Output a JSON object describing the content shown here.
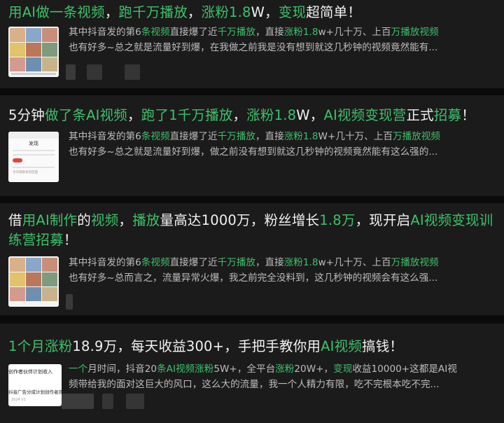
{
  "results": [
    {
      "title": [
        {
          "t": "用AI做一条视频",
          "hl": true
        },
        {
          "t": "，",
          "hl": false
        },
        {
          "t": "跑千万播放",
          "hl": true
        },
        {
          "t": "，",
          "hl": false
        },
        {
          "t": "涨粉1.8",
          "hl": true
        },
        {
          "t": "W，",
          "hl": false
        },
        {
          "t": "变现",
          "hl": true
        },
        {
          "t": "超简单！",
          "hl": false
        }
      ],
      "snippet_lines": [
        [
          {
            "t": "其中抖音发的第6",
            "hl": false
          },
          {
            "t": "条视频",
            "hl": true
          },
          {
            "t": "直接爆了近",
            "hl": false
          },
          {
            "t": "千万播放",
            "hl": true
          },
          {
            "t": "，直接",
            "hl": false
          },
          {
            "t": "涨粉1.8",
            "hl": true
          },
          {
            "t": "w+几十万、上百",
            "hl": false
          },
          {
            "t": "万播放视频",
            "hl": true
          }
        ],
        [
          {
            "t": "也有好多~总之就是流量好到爆，在我做之前我是没有想到就这几秒钟的视频竟然能有...",
            "hl": false
          }
        ]
      ]
    },
    {
      "title": [
        {
          "t": "5分钟",
          "hl": false
        },
        {
          "t": "做了条AI视频",
          "hl": true
        },
        {
          "t": "，",
          "hl": false
        },
        {
          "t": "跑了1千万播放",
          "hl": true
        },
        {
          "t": "，",
          "hl": false
        },
        {
          "t": "涨粉1.8",
          "hl": true
        },
        {
          "t": "W，",
          "hl": false
        },
        {
          "t": "AI视频变现营",
          "hl": true
        },
        {
          "t": "正式",
          "hl": false
        },
        {
          "t": "招募",
          "hl": true
        },
        {
          "t": "！",
          "hl": false
        }
      ],
      "snippet_lines": [
        [
          {
            "t": "其中抖音发的第6",
            "hl": false
          },
          {
            "t": "条视频",
            "hl": true
          },
          {
            "t": "直接爆了近",
            "hl": false
          },
          {
            "t": "千万播放",
            "hl": true
          },
          {
            "t": "，直接",
            "hl": false
          },
          {
            "t": "涨粉1.8",
            "hl": true
          },
          {
            "t": "W+几十万、上百",
            "hl": false
          },
          {
            "t": "万播放视频",
            "hl": true
          }
        ],
        [
          {
            "t": "也有好多~总之就是流量好到爆，做之前没有想到就这几秒钟的视频竟然能有这么强的...",
            "hl": false
          }
        ]
      ]
    },
    {
      "title": [
        {
          "t": "借",
          "hl": false
        },
        {
          "t": "用AI制作",
          "hl": true
        },
        {
          "t": "的",
          "hl": false
        },
        {
          "t": "视频",
          "hl": true
        },
        {
          "t": "，",
          "hl": false
        },
        {
          "t": "播放",
          "hl": true
        },
        {
          "t": "量高达1000万，粉丝增长",
          "hl": false
        },
        {
          "t": "1.8万",
          "hl": true
        },
        {
          "t": "，现开启",
          "hl": false
        },
        {
          "t": "AI视频变现训",
          "hl": true
        }
      ],
      "title_line2": [
        {
          "t": "练营招募",
          "hl": true
        },
        {
          "t": "！",
          "hl": false
        }
      ],
      "snippet_lines": [
        [
          {
            "t": "其中抖音发的第6",
            "hl": false
          },
          {
            "t": "条视频",
            "hl": true
          },
          {
            "t": "直接爆了近",
            "hl": false
          },
          {
            "t": "千万播放",
            "hl": true
          },
          {
            "t": "，直接",
            "hl": false
          },
          {
            "t": "涨粉1.8",
            "hl": true
          },
          {
            "t": "w+几十万、上百",
            "hl": false
          },
          {
            "t": "万播放视频",
            "hl": true
          }
        ],
        [
          {
            "t": "也有好多~总而言之，流量异常火爆，我之前完全没料到，这几秒钟的视频会有这么强...",
            "hl": false
          }
        ]
      ]
    },
    {
      "title": [
        {
          "t": "1个月",
          "hl": true
        },
        {
          "t": "涨粉",
          "hl": true
        },
        {
          "t": "18.9万，每天收益300+，手把手教你用",
          "hl": false
        },
        {
          "t": "AI视频",
          "hl": true
        },
        {
          "t": "搞钱！",
          "hl": false
        }
      ],
      "snippet_lines": [
        [
          {
            "t": "一个",
            "hl": true
          },
          {
            "t": "月时间，抖音20",
            "hl": false
          },
          {
            "t": "条AI视频涨粉",
            "hl": true
          },
          {
            "t": "5W+，全平台",
            "hl": false
          },
          {
            "t": "涨粉",
            "hl": true
          },
          {
            "t": "20W+，",
            "hl": false
          },
          {
            "t": "变现",
            "hl": true
          },
          {
            "t": "收益10000+这都是AI视",
            "hl": false
          }
        ],
        [
          {
            "t": "频带给我的面对这巨大的风口，这么大的流量，我一个人精力有限，吃不完根本吃不完...",
            "hl": false
          }
        ]
      ]
    }
  ],
  "thumbnails": {
    "t2_heading": "发现",
    "t2_caption": "也叫观察发现后面",
    "t4_line1": "创作者伙伴计划收入",
    "t4_line2": "抖音广告分成计划创作者测",
    "t4_date": "2024 V1"
  },
  "colors": {
    "background": "#0b0b0b",
    "card": "#1b1b1b",
    "highlight": "#3fc06a",
    "title": "#f2f2f2",
    "snippet": "#bdbdbd"
  }
}
